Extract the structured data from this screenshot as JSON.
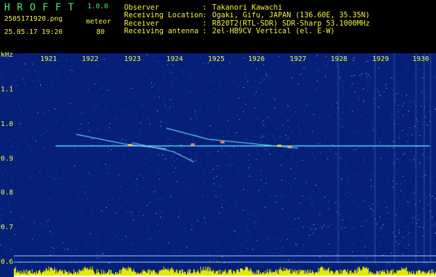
{
  "header": {
    "app_name": "HROFFT",
    "version": "1.0.0",
    "filename": "2505171920.png",
    "mode": "meteor",
    "datetime": "25.05.17 19:20",
    "count": "80"
  },
  "info": [
    {
      "label": "Observer",
      "value": "Takanori Kawachi"
    },
    {
      "label": "Receiving Location",
      "value": "Ogaki, Gifu, JAPAN (136.60E, 35.35N)"
    },
    {
      "label": "Receiver",
      "value": "R820T2(RTL-SDR) SDR-Sharp 53.1000MHz"
    },
    {
      "label": "Receiving antenna",
      "value": "2el-HB9CV Vertical (el. E-W)"
    }
  ],
  "axis": {
    "unit": "kHz",
    "y_ticks": [
      "1.1",
      "1.0",
      "0.9",
      "0.8",
      "0.7",
      "0.6"
    ],
    "x_ticks": [
      "1921",
      "1922",
      "1923",
      "1924",
      "1925",
      "1926",
      "1927",
      "1928",
      "1929",
      "1930"
    ]
  },
  "colors": {
    "background": "#06207a",
    "label_yellow": "#f5f53c",
    "title_green": "#49f06b",
    "signal_cyan": "#5fe6ff",
    "grid_line": "#9fd1ff"
  }
}
